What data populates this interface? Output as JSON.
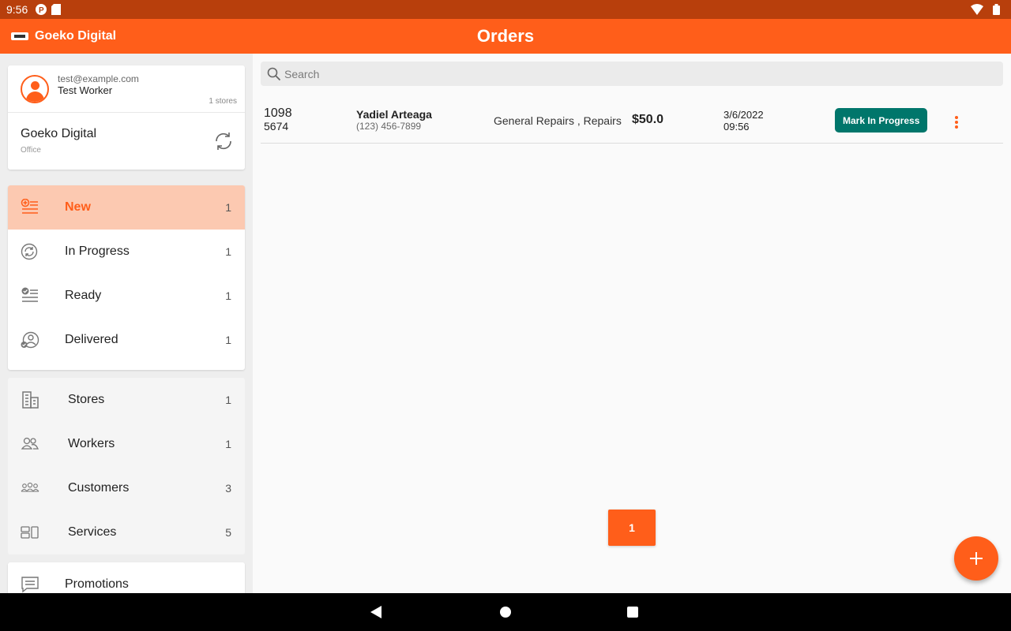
{
  "status_bar": {
    "time": "9:56"
  },
  "app": {
    "brand_name": "Goeko Digital",
    "title": "Orders",
    "accent_color": "#ff5e1a"
  },
  "user": {
    "email": "test@example.com",
    "name": "Test Worker",
    "stores_count": "1 stores"
  },
  "store": {
    "name": "Goeko Digital",
    "type": "Office"
  },
  "status_nav": [
    {
      "label": "New",
      "count": "1",
      "icon": "new-list-icon"
    },
    {
      "label": "In Progress",
      "count": "1",
      "icon": "sync-circle-icon"
    },
    {
      "label": "Ready",
      "count": "1",
      "icon": "checklist-icon"
    },
    {
      "label": "Delivered",
      "count": "1",
      "icon": "person-check-icon"
    }
  ],
  "mgmt_nav": [
    {
      "label": "Stores",
      "count": "1",
      "icon": "building-icon"
    },
    {
      "label": "Workers",
      "count": "1",
      "icon": "workers-icon"
    },
    {
      "label": "Customers",
      "count": "3",
      "icon": "customers-icon"
    },
    {
      "label": "Services",
      "count": "5",
      "icon": "services-icon"
    }
  ],
  "promo_nav": {
    "label": "Promotions",
    "icon": "message-icon"
  },
  "search": {
    "placeholder": "Search"
  },
  "orders": [
    {
      "number": "1098",
      "sub_number": "5674",
      "customer_name": "Yadiel Arteaga",
      "customer_phone": "(123) 456-7899",
      "services": "General Repairs , Repairs",
      "price": "$50.0",
      "date": "3/6/2022",
      "time": "09:56",
      "action_label": "Mark In Progress"
    }
  ],
  "pagination": {
    "current_page": "1"
  }
}
